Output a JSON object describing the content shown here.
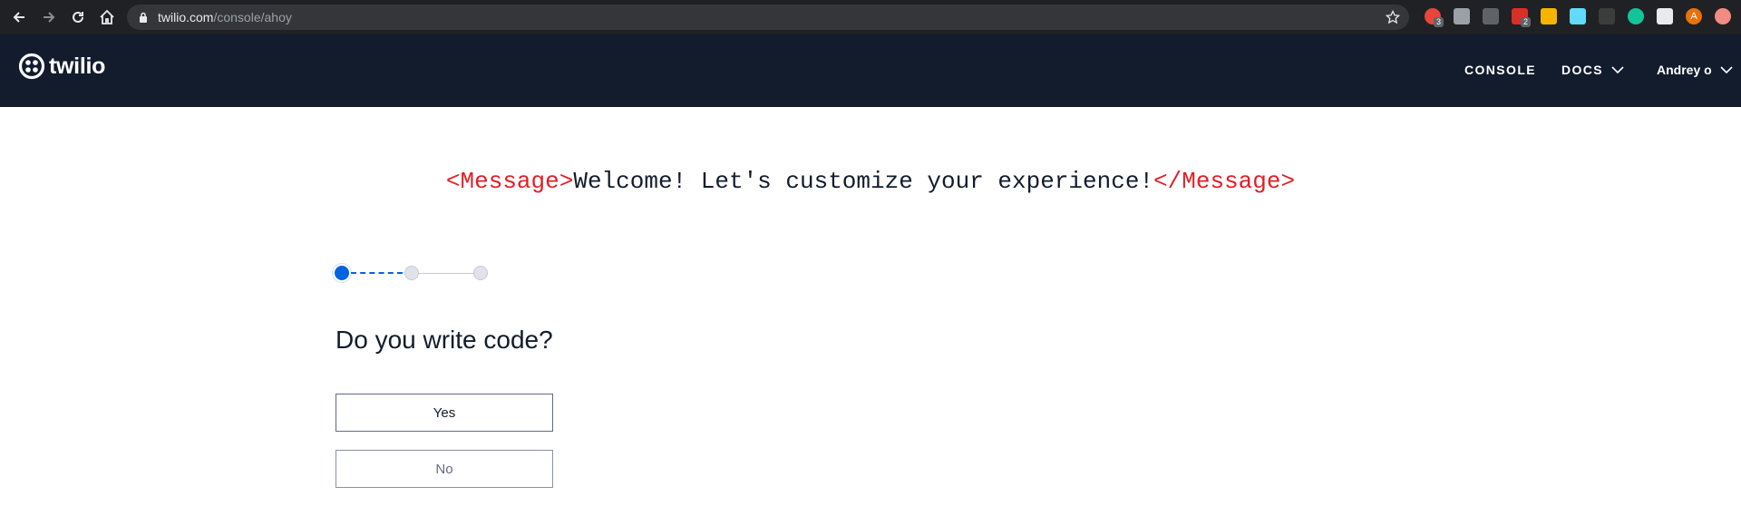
{
  "browser": {
    "url_host": "twilio.com",
    "url_path": "/console/ahoy",
    "back_icon": "arrow-left-icon",
    "forward_icon": "arrow-right-icon",
    "reload_icon": "reload-icon",
    "home_icon": "home-icon",
    "extensions": [
      {
        "name": "extension-red-icon",
        "color": "#e8453c",
        "badge": "3"
      },
      {
        "name": "extension-camera-icon",
        "color": "#9aa0a6",
        "badge": ""
      },
      {
        "name": "extension-rocket-icon",
        "color": "#5f6368",
        "badge": ""
      },
      {
        "name": "extension-todo-icon",
        "color": "#d93025",
        "badge": "2"
      },
      {
        "name": "extension-colorwheel-icon",
        "color": "#f4b400",
        "badge": ""
      },
      {
        "name": "extension-react-icon",
        "color": "#61dafb",
        "badge": ""
      },
      {
        "name": "extension-dark-icon",
        "color": "#3c3c3c",
        "badge": ""
      },
      {
        "name": "extension-grammarly-icon",
        "color": "#15c39a",
        "badge": ""
      },
      {
        "name": "extensions-puzzle-icon",
        "color": "#e8eaed",
        "badge": ""
      },
      {
        "name": "profile-avatar",
        "color": "#e8710a",
        "badge": "",
        "letter": "A"
      },
      {
        "name": "extension-pink-icon",
        "color": "#f28b82",
        "badge": ""
      }
    ]
  },
  "header": {
    "logo_text": "twilio",
    "nav": {
      "console": "CONSOLE",
      "docs": "DOCS",
      "user": "Andrey o"
    }
  },
  "main": {
    "headline_open_tag": "<Message>",
    "headline_text": "Welcome! Let's customize your experience!",
    "headline_close_tag": "</Message>",
    "steps_total": 3,
    "current_step": 1,
    "question": "Do you write code?",
    "answers": {
      "yes": "Yes",
      "no": "No"
    }
  },
  "colors": {
    "header_bg": "#121c2d",
    "accent_blue": "#0263e0",
    "tag_red": "#e31e26"
  }
}
